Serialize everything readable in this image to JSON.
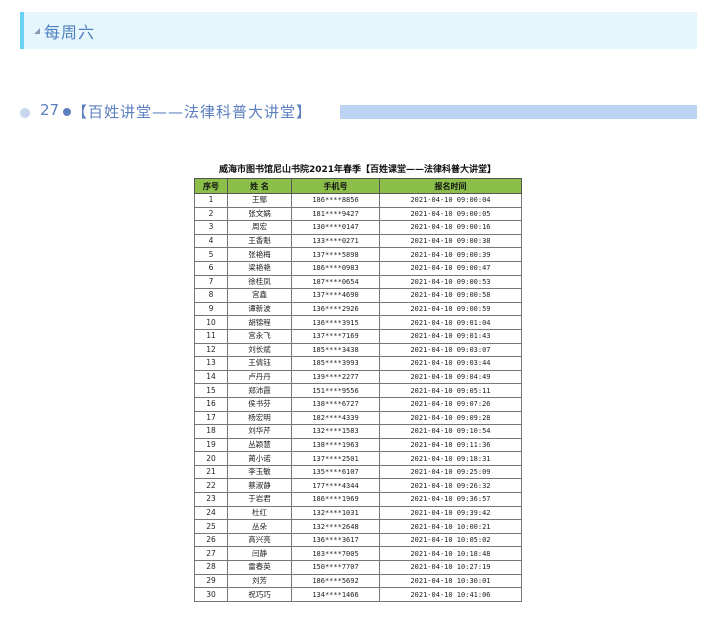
{
  "section": {
    "title": "每周六"
  },
  "event": {
    "number": "27",
    "title": "【百姓讲堂——法律科普大讲堂】"
  },
  "table": {
    "title": "威海市图书馆尼山书院2021年春季【百姓课堂——法律科普大讲堂】",
    "headers": [
      "序号",
      "姓  名",
      "手机号",
      "报名时间"
    ],
    "rows": [
      [
        "1",
        "王鄢",
        "186****8856",
        "2021-04-10 09:00:04"
      ],
      [
        "2",
        "张文娲",
        "181****9427",
        "2021-04-10 09:00:05"
      ],
      [
        "3",
        "周宏",
        "130****0147",
        "2021-04-10 09:00:16"
      ],
      [
        "4",
        "王香魁",
        "133****0271",
        "2021-04-10 09:00:38"
      ],
      [
        "5",
        "张艳梅",
        "137****5898",
        "2021-04-10 09:00:39"
      ],
      [
        "6",
        "梁艳艳",
        "186****0983",
        "2021-04-10 09:00:47"
      ],
      [
        "7",
        "徐桂凤",
        "187****0654",
        "2021-04-10 09:00:53"
      ],
      [
        "8",
        "宫鑫",
        "137****4690",
        "2021-04-10 09:00:58"
      ],
      [
        "9",
        "谭新波",
        "136****2926",
        "2021-04-10 09:00:59"
      ],
      [
        "10",
        "胡锦程",
        "136****3915",
        "2021-04-10 09:01:04"
      ],
      [
        "11",
        "宫永飞",
        "137****7169",
        "2021-04-10 09:01:43"
      ],
      [
        "12",
        "刘长斌",
        "185****3438",
        "2021-04-10 09:03:07"
      ],
      [
        "13",
        "王倩钰",
        "185****3993",
        "2021-04-10 09:03:44"
      ],
      [
        "14",
        "卢丹丹",
        "139****2277",
        "2021-04-10 09:04:49"
      ],
      [
        "15",
        "郑沛霞",
        "151****9556",
        "2021-04-10 09:05:11"
      ],
      [
        "16",
        "侯书芬",
        "138****6727",
        "2021-04-10 09:07:26"
      ],
      [
        "17",
        "杨宏明",
        "182****4339",
        "2021-04-10 09:09:28"
      ],
      [
        "18",
        "刘华芹",
        "132****1583",
        "2021-04-10 09:10:54"
      ],
      [
        "19",
        "丛颖慧",
        "138****1963",
        "2021-04-10 09:11:36"
      ],
      [
        "20",
        "蔺小诺",
        "137****2501",
        "2021-04-10 09:18:31"
      ],
      [
        "21",
        "李玉敏",
        "135****6107",
        "2021-04-10 09:25:09"
      ],
      [
        "22",
        "蔡淑静",
        "177****4344",
        "2021-04-10 09:26:32"
      ],
      [
        "23",
        "于岩君",
        "186****1969",
        "2021-04-10 09:36:57"
      ],
      [
        "24",
        "杜红",
        "132****1031",
        "2021-04-10 09:39:42"
      ],
      [
        "25",
        "丛朵",
        "132****2648",
        "2021-04-10 10:00:21"
      ],
      [
        "26",
        "高兴亮",
        "136****3617",
        "2021-04-10 10:05:02"
      ],
      [
        "27",
        "闫静",
        "183****7005",
        "2021-04-10 10:18:48"
      ],
      [
        "28",
        "雷春英",
        "150****7707",
        "2021-04-10 10:27:19"
      ],
      [
        "29",
        "刘芳",
        "186****5692",
        "2021-04-10 10:30:01"
      ],
      [
        "30",
        "祝巧巧",
        "134****1466",
        "2021-04-10 10:41:06"
      ]
    ]
  },
  "colors": {
    "header_accent": "#69d1f2",
    "header_bg": "#e6f6fd",
    "link_blue": "#5b7fbf",
    "table_header": "#8bbf4a"
  }
}
